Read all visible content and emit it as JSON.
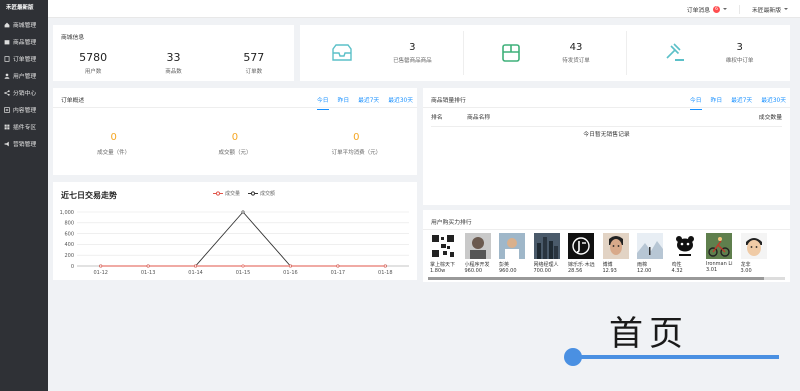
{
  "sidebar": {
    "logo": "禾匠最新版",
    "items": [
      {
        "label": "商城管理",
        "icon": "home-icon"
      },
      {
        "label": "商品管理",
        "icon": "box-icon"
      },
      {
        "label": "订单管理",
        "icon": "order-icon"
      },
      {
        "label": "用户管理",
        "icon": "user-icon"
      },
      {
        "label": "分销中心",
        "icon": "share-icon"
      },
      {
        "label": "内容管理",
        "icon": "content-icon"
      },
      {
        "label": "插件专区",
        "icon": "plugin-icon"
      },
      {
        "label": "营销管理",
        "icon": "marketing-icon"
      }
    ]
  },
  "topbar": {
    "order_msg": "订单消息",
    "order_badge": "6",
    "store_name": "禾匠最新版"
  },
  "mall_info": {
    "title": "商城信息",
    "stats": [
      {
        "value": "5780",
        "label": "用户数"
      },
      {
        "value": "33",
        "label": "商品数"
      },
      {
        "value": "577",
        "label": "订单数"
      }
    ]
  },
  "todo": {
    "items": [
      {
        "value": "3",
        "label": "已售罄商品商品",
        "icon": "inbox-icon"
      },
      {
        "value": "43",
        "label": "待发货订单",
        "icon": "grid-box-icon"
      },
      {
        "value": "3",
        "label": "维权中订单",
        "icon": "gavel-icon"
      }
    ]
  },
  "order_overview": {
    "title": "订单概述",
    "tabs": [
      "今日",
      "昨日",
      "最近7天",
      "最近30天"
    ],
    "stats": [
      {
        "value": "0",
        "label": "成交量（件）"
      },
      {
        "value": "0",
        "label": "成交额（元）"
      },
      {
        "value": "0",
        "label": "订单平均消费（元）"
      }
    ]
  },
  "sales_rank": {
    "title": "商品销量排行",
    "tabs": [
      "今日",
      "昨日",
      "最近7天",
      "最近30天"
    ],
    "columns": [
      "排名",
      "商品名称",
      "成交数量"
    ],
    "empty": "今日暂无销售记录"
  },
  "trend": {
    "title": "近七日交易走势",
    "legend": [
      "成交量",
      "成交额"
    ]
  },
  "chart_data": {
    "type": "line",
    "categories": [
      "01-12",
      "01-13",
      "01-14",
      "01-15",
      "01-16",
      "01-17",
      "01-18"
    ],
    "series": [
      {
        "name": "成交量",
        "values": [
          0,
          0,
          0,
          0,
          0,
          0,
          0
        ],
        "color": "#e0554a"
      },
      {
        "name": "成交额",
        "values": [
          0,
          0,
          0,
          1000,
          0,
          0,
          0
        ],
        "color": "#333333"
      }
    ],
    "yticks": [
      "0",
      "200",
      "400",
      "600",
      "800",
      "1,000"
    ],
    "ylim": [
      0,
      1000
    ],
    "grid": true
  },
  "buyer_rank": {
    "title": "用户购买力排行",
    "buyers": [
      {
        "name": "掌上棕天下",
        "amount": "1.80w",
        "avatar": "qr"
      },
      {
        "name": "小程序开发",
        "amount": "960.00",
        "avatar": "person"
      },
      {
        "name": "彭英",
        "amount": "960.00",
        "avatar": "person2"
      },
      {
        "name": "网络经理人",
        "amount": "700.00",
        "avatar": "city"
      },
      {
        "name": "嫁乐乐·木远",
        "amount": "28.56",
        "avatar": "logo-dark"
      },
      {
        "name": "博博",
        "amount": "12.93",
        "avatar": "face"
      },
      {
        "name": "雨棉",
        "amount": "12.00",
        "avatar": "snow"
      },
      {
        "name": "鸡性",
        "amount": "4.32",
        "avatar": "panda"
      },
      {
        "name": "Ironman Li",
        "amount": "3.01",
        "avatar": "bike"
      },
      {
        "name": "龙非",
        "amount": "3.00",
        "avatar": "kid"
      }
    ]
  },
  "watermark": {
    "text": "首页"
  },
  "colors": {
    "sidebar_bg": "#2f3136",
    "accent": "#1890ff",
    "orange": "#f5a623",
    "teal": "#5bc0c8"
  }
}
